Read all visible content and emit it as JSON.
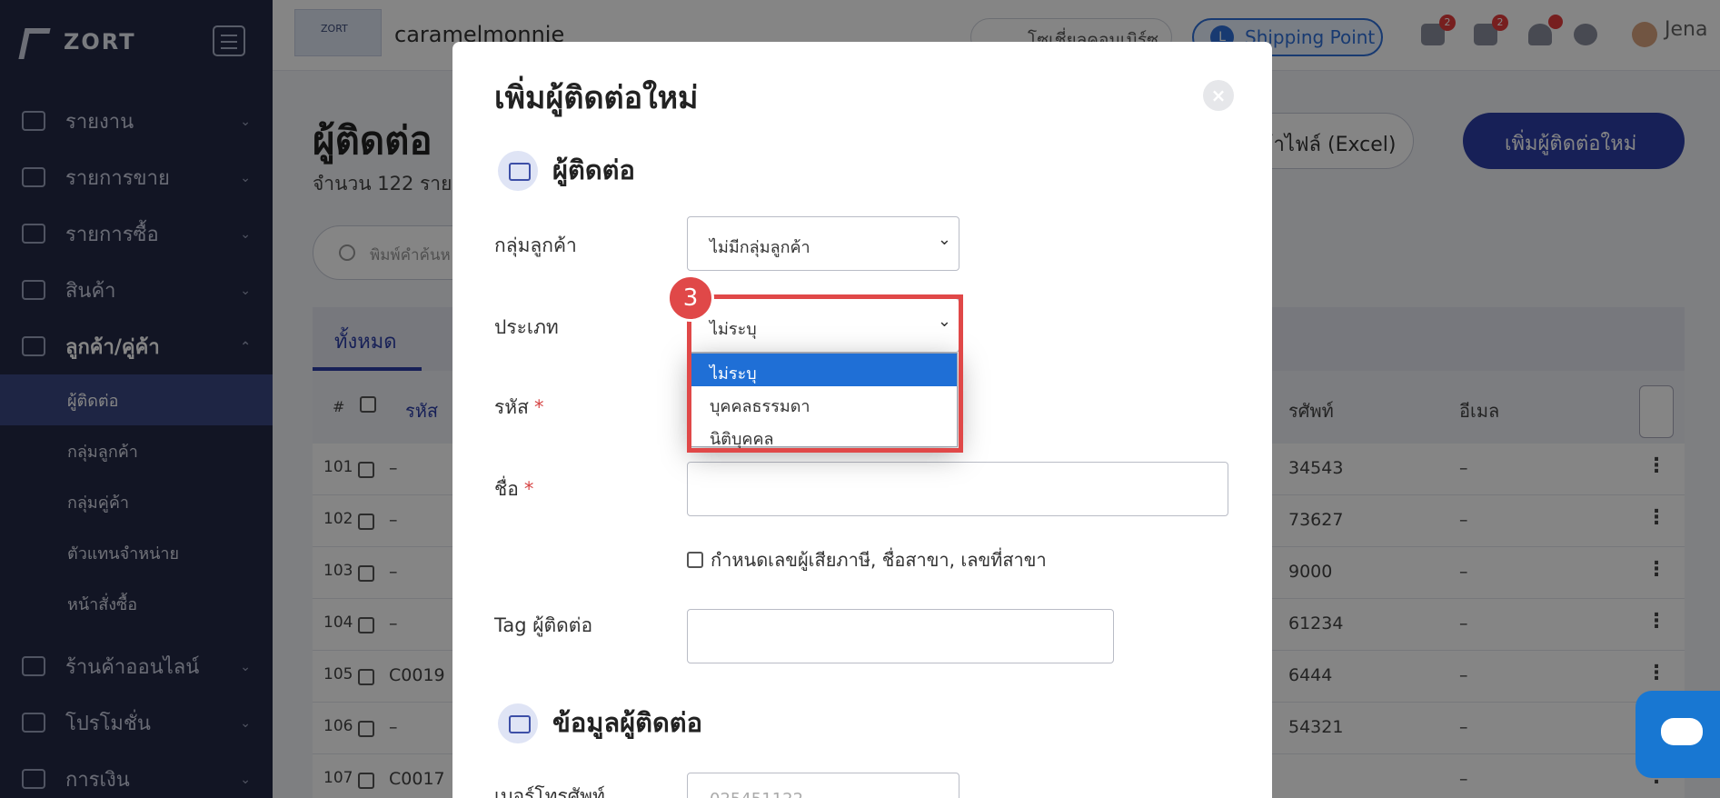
{
  "sidebar": {
    "brand": "ZORT",
    "items": [
      {
        "label": "รายงาน"
      },
      {
        "label": "รายการขาย"
      },
      {
        "label": "รายการซื้อ"
      },
      {
        "label": "สินค้า"
      },
      {
        "label": "ลูกค้า/คู่ค้า"
      }
    ],
    "sub_items": [
      {
        "label": "ผู้ติดต่อ"
      },
      {
        "label": "กลุ่มลูกค้า"
      },
      {
        "label": "กลุ่มคู่ค้า"
      },
      {
        "label": "ตัวแทนจำหน่าย"
      },
      {
        "label": "หน้าสั่งซื้อ"
      }
    ],
    "items_bottom": [
      {
        "label": "ร้านค้าออนไลน์"
      },
      {
        "label": "โปรโมชั่น"
      },
      {
        "label": "การเงิน"
      }
    ]
  },
  "topbar": {
    "shop_logo_text": "ZORT",
    "shop_name": "caramelmonnie",
    "chat_label": "โซเชี่ยลคอมเมิร์ซ",
    "shipping_label": "Shipping Point",
    "badge_1": "2",
    "badge_2": "2",
    "user_name": "Jena"
  },
  "main": {
    "title": "ผู้ติดต่อ",
    "count_text": "จำนวน 122 ราย",
    "import_label": "เข้าไฟล์ (Excel)",
    "add_label": "เพิ่มผู้ติดต่อใหม่",
    "search_placeholder": "พิมพ์คำค้นห",
    "tab_all": "ทั้งหมด",
    "columns": {
      "num": "#",
      "code": "รหัส",
      "phone": "รศัพท์",
      "email": "อีเมล"
    },
    "rows": [
      {
        "num": "101",
        "code": "–",
        "phone": "34543",
        "email": "–"
      },
      {
        "num": "102",
        "code": "–",
        "phone": "73627",
        "email": "–"
      },
      {
        "num": "103",
        "code": "–",
        "phone": "9000",
        "email": "–"
      },
      {
        "num": "104",
        "code": "–",
        "phone": "61234",
        "email": "–"
      },
      {
        "num": "105",
        "code": "C0019",
        "phone": "6444",
        "email": "–"
      },
      {
        "num": "106",
        "code": "–",
        "phone": "54321",
        "email": "–"
      },
      {
        "num": "107",
        "code": "C0017",
        "phone": "",
        "email": "–"
      }
    ]
  },
  "modal": {
    "title": "เพิ่มผู้ติดต่อใหม่",
    "section_contact": "ผู้ติดต่อ",
    "group_label": "กลุ่มลูกค้า",
    "group_value": "ไม่มีกลุ่มลูกค้า",
    "type_label": "ประเภท",
    "type_value": "ไม่ระบุ",
    "type_options": [
      "ไม่ระบุ",
      "บุคคลธรรมดา",
      "นิติบุคคล"
    ],
    "code_label": "รหัส",
    "name_label": "ชื่อ",
    "required_mark": "*",
    "tax_checkbox_label": "กำหนดเลขผู้เสียภาษี, ชื่อสาขา, เลขที่สาขา",
    "tag_label": "Tag ผู้ติดต่อ",
    "section_info": "ข้อมูลผู้ติดต่อ",
    "phone_label": "เบอร์โทรศัพท์",
    "phone_placeholder": "025451122"
  },
  "annotation": {
    "step": "3"
  },
  "colors": {
    "sidebar": "#232a45",
    "accent": "#2c3fa8",
    "highlight": "#e04848",
    "dropdown_selected": "#1f6fd6"
  }
}
